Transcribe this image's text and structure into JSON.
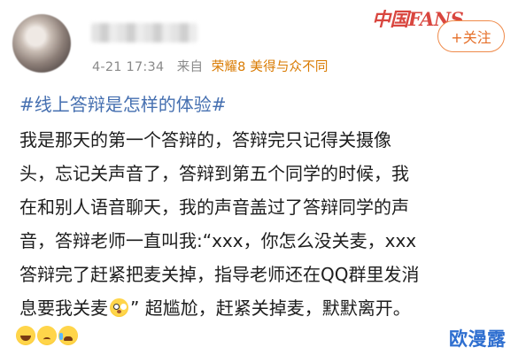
{
  "post": {
    "meta": {
      "time": "4-21 17:34",
      "from_label": "来自",
      "device": "荣耀8 美得与众不同"
    },
    "follow_label": "+关注",
    "topic": "#线上答辩是怎样的体验#",
    "lines": [
      "我是那天的第一个答辩的，答辩完只记得关摄像",
      "头，忘记关声音了，答辩到第五个同学的时候，我",
      "在和别人语音聊天，我的声音盖过了答辩同学的声",
      "音，答辩老师一直叫我:“xxx，你怎么没关麦，xxx",
      "答辩完了赶紧把麦关掉，指导老师还在QQ群里发消"
    ],
    "last_line_before_emoji": "息要我关麦",
    "last_line_after_emoji": "” 超尴尬，赶紧关掉麦，默默离开。",
    "inline_emoji": "flushed-face",
    "reactions": [
      "laughing-crying-face",
      "sad-face",
      "crying-face"
    ]
  },
  "brand_logo": "中国FANS",
  "watermark": "欧漫露",
  "colors": {
    "topic": "#456fb0",
    "device": "#d97a00",
    "follow": "#e6702a",
    "logo": "#d9463f",
    "watermark": "#2f6fd0"
  }
}
